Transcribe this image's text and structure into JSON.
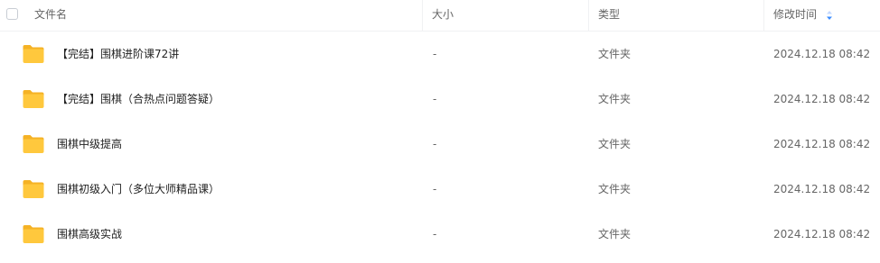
{
  "header": {
    "name_label": "文件名",
    "size_label": "大小",
    "type_label": "类型",
    "mtime_label": "修改时间"
  },
  "icons": {
    "folder": "folder-icon",
    "sort": "sort-arrows-icon",
    "checkbox": "select-all-checkbox"
  },
  "colors": {
    "folder_yellow": "#ffc83d",
    "sort_accent": "#3b8cff"
  },
  "rows": [
    {
      "name": "【完结】围棋进阶课72讲",
      "size": "-",
      "type": "文件夹",
      "mtime": "2024.12.18 08:42"
    },
    {
      "name": "【完结】围棋（合热点问题答疑）",
      "size": "-",
      "type": "文件夹",
      "mtime": "2024.12.18 08:42"
    },
    {
      "name": "围棋中级提高",
      "size": "-",
      "type": "文件夹",
      "mtime": "2024.12.18 08:42"
    },
    {
      "name": "围棋初级入门（多位大师精品课）",
      "size": "-",
      "type": "文件夹",
      "mtime": "2024.12.18 08:42"
    },
    {
      "name": "围棋高级实战",
      "size": "-",
      "type": "文件夹",
      "mtime": "2024.12.18 08:42"
    }
  ]
}
